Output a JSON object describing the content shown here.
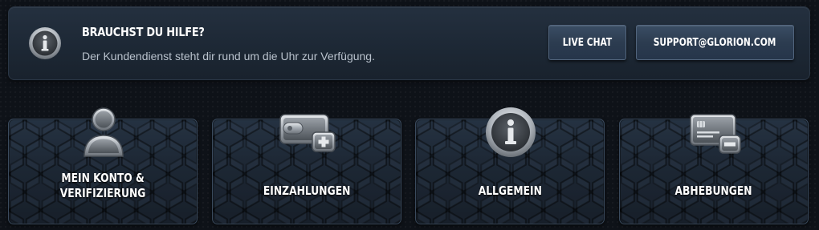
{
  "help": {
    "title": "BRAUCHST DU HILFE?",
    "subtitle": "Der Kundendienst steht dir rund um die Uhr zur Verfügung.",
    "icon": "info-icon",
    "buttons": {
      "live_chat": "LIVE CHAT",
      "support": "SUPPORT@GLORION.COM"
    }
  },
  "categories": [
    {
      "label": "MEIN KONTO &\nVERIFIZIERUNG",
      "icon": "user-icon"
    },
    {
      "label": "EINZAHLUNGEN",
      "icon": "wallet-plus-icon"
    },
    {
      "label": "ALLGEMEIN",
      "icon": "info-icon"
    },
    {
      "label": "ABHEBUNGEN",
      "icon": "card-minus-icon"
    }
  ],
  "colors": {
    "background": "#0e1218",
    "banner": "#1d2835",
    "button": "#2c3c50",
    "card_border": "#3a4a5d",
    "text": "#ffffff",
    "subtext": "#b9c2cd"
  }
}
